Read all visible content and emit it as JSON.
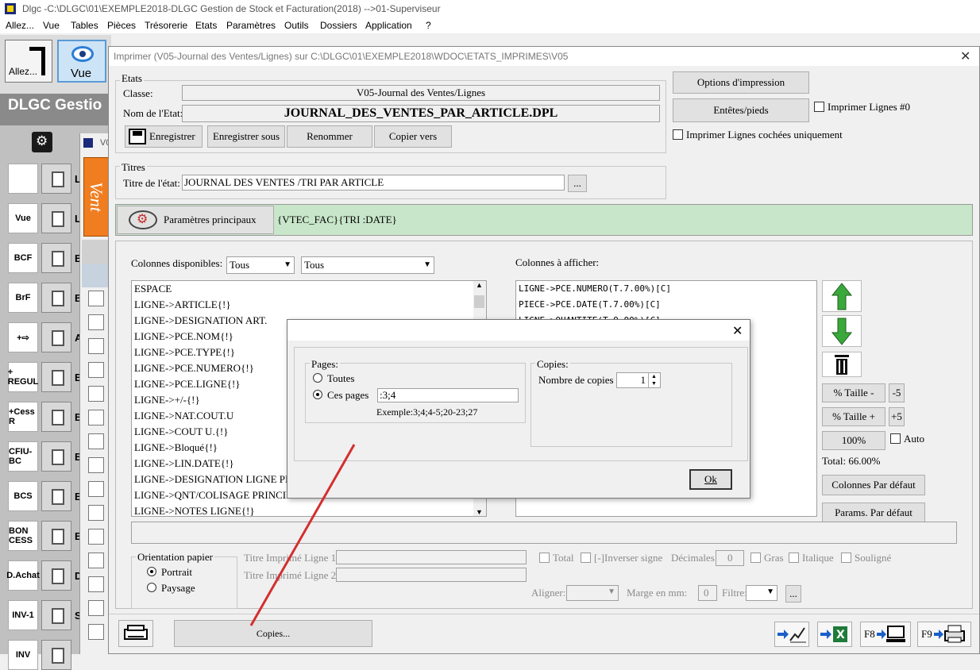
{
  "app": {
    "title": "Dlgc -C:\\DLGC\\01\\EXEMPLE2018-DLGC Gestion de Stock et Facturation(2018) -->01-Superviseur",
    "menu": [
      "Allez...",
      "Vue",
      "Tables",
      "Pièces",
      "Trésorerie",
      "Etats",
      "Paramètres",
      "Outils",
      "Dossiers",
      "Application",
      "?"
    ],
    "allez_label": "Allez...",
    "vue_label": "Vue",
    "banner": "DLGC Gestio",
    "sub_title": "V0",
    "ventes_label": "Vent",
    "side_tools": [
      {
        "icon": "warning-info-icon",
        "letter": "L",
        "text": ""
      },
      {
        "icon": "vue-icon",
        "letter": "L",
        "text": "Vue"
      },
      {
        "icon": "bcf-icon",
        "letter": "B",
        "text": "BCF"
      },
      {
        "icon": "brf-icon",
        "letter": "B",
        "text": "BrF"
      },
      {
        "icon": "plus-arrow-icon",
        "letter": "A",
        "text": "+⇨"
      },
      {
        "icon": "regul-icon",
        "letter": "B",
        "text": "+ REGUL"
      },
      {
        "icon": "cess-icon",
        "letter": "B",
        "text": "+Cess R"
      },
      {
        "icon": "cfiu-icon",
        "letter": "B",
        "text": "CFIU-BC"
      },
      {
        "icon": "bcs-icon",
        "letter": "B",
        "text": "BCS"
      },
      {
        "icon": "bon-cess-icon",
        "letter": "B",
        "text": "BON CESS"
      },
      {
        "icon": "achat-icon",
        "letter": "D",
        "text": "D.Achat"
      },
      {
        "icon": "inv-icon",
        "letter": "S",
        "text": "INV-1"
      },
      {
        "icon": "inv2-icon",
        "letter": "",
        "text": "INV"
      }
    ]
  },
  "print_window": {
    "title": "Imprimer (V05-Journal des Ventes/Lignes)  sur C:\\DLGC\\01\\EXEMPLE2018\\WDOC\\ETATS_IMPRIMES\\V05",
    "etats": {
      "legend": "Etats",
      "classe_label": "Classe:",
      "classe_value": "V05-Journal des Ventes/Lignes",
      "nom_label": "Nom de l'Etat:",
      "nom_value": "JOURNAL_DES_VENTES_PAR_ARTICLE.DPL",
      "enregistrer": "Enregistrer",
      "enregistrer_sous": "Enregistrer sous",
      "renommer": "Renommer",
      "copier_vers": "Copier vers"
    },
    "options_impression": "Options d'impression",
    "entetes_pieds": "Entêtes/pieds",
    "imprimer_lignes_0": "Imprimer Lignes #0",
    "imprimer_cochees": "Imprimer Lignes cochées uniquement",
    "titres": {
      "legend": "Titres",
      "titre_label": "Titre de l'état:",
      "titre_value": "JOURNAL DES VENTES /TRI PAR ARTICLE",
      "ellipsis": "..."
    },
    "params_principaux": "Paramètres principaux",
    "params_value": "{VTEC_FAC}{TRI :DATE}",
    "colonnes_disponibles_label": "Colonnes disponibles:",
    "filter1": "Tous",
    "filter2": "Tous",
    "colonnes_afficher_label": "Colonnes à afficher:",
    "available_columns": [
      "ESPACE",
      "LIGNE->ARTICLE{!}",
      "LIGNE->DESIGNATION ART.",
      "LIGNE->PCE.NOM{!}",
      "LIGNE->PCE.TYPE{!}",
      "LIGNE->PCE.NUMERO{!}",
      "LIGNE->PCE.LIGNE{!}",
      "LIGNE->+/-{!}",
      "LIGNE->NAT.COUT.U",
      "LIGNE->COUT U.{!}",
      "LIGNE->Bloqué{!}",
      "LIGNE->LIN.DATE{!}",
      "LIGNE->DESIGNATION LIGNE PIEC",
      "LIGNE->QNT/COLISAGE PRINCIPALE",
      "LIGNE->NOTES LIGNE{!}"
    ],
    "display_columns": [
      "LIGNE->PCE.NUMERO(T.7.00%)[C]",
      "PIECE->PCE.DATE(T.7.00%)[C]",
      "LIGNE->QUANTITE(T.9.00%)[C]"
    ],
    "taille_minus": "% Taille -",
    "minus5": "-5",
    "taille_plus": "% Taille +",
    "plus5": "+5",
    "pct100": "100%",
    "auto": "Auto",
    "total": "Total:  66.00%",
    "colonnes_defaut": "Colonnes Par défaut",
    "params_defaut": "Params. Par défaut",
    "orientation": {
      "legend": "Orientation papier",
      "portrait": "Portrait",
      "paysage": "Paysage"
    },
    "titre_ligne1": "Titre Imprimé Ligne 1:",
    "titre_ligne2": "Titre Imprimé Ligne 2:",
    "total_cb": "Total",
    "inverser": "[-]Inverser signe",
    "decimales": "Décimales:",
    "decimales_value": "0",
    "gras": "Gras",
    "italique": "Italique",
    "souligne": "Souligné",
    "aligner": "Aligner:",
    "marge": "Marge en mm:",
    "marge_value": "0",
    "filtre": "Filtre:",
    "copies_button": "Copies...",
    "f8": "F8",
    "f9": "F9"
  },
  "copies_dialog": {
    "pages_legend": "Pages:",
    "toutes": "Toutes",
    "ces_pages": "Ces pages",
    "pages_value": ":3;4",
    "exemple": "Exemple:3;4;4-5;20-23;27",
    "copies_legend": "Copies:",
    "nombre_label": "Nombre de copies",
    "nombre_value": "1",
    "ok": "Ok"
  },
  "colors": {
    "green_bar": "#c8e6c9",
    "annotation_arrow": "#d32f2f",
    "banner_bg": "#8a8a8a"
  }
}
